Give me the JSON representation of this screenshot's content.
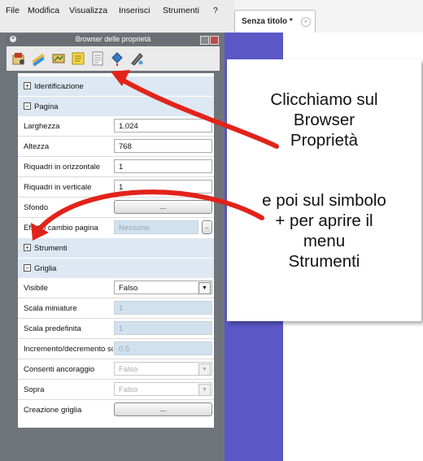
{
  "menubar": {
    "items": [
      "File",
      "Modifica",
      "Visualizza",
      "Inserisci",
      "Strumenti",
      "?"
    ]
  },
  "tab": {
    "label": "Senza titolo *",
    "close_icon": "close-icon"
  },
  "panel": {
    "title": "Browser delle proprietà",
    "tool_icons": [
      "page-settings-icon",
      "pencil-tools-icon",
      "flipchart-icon",
      "notes-icon",
      "properties-page-icon",
      "fill-bucket-icon",
      "pen-icon"
    ]
  },
  "sections": {
    "identificazione": {
      "label": "Identificazione",
      "expand": "+"
    },
    "pagina": {
      "label": "Pagina",
      "expand": "−"
    },
    "strumenti": {
      "label": "Strumenti",
      "expand": "+"
    },
    "griglia": {
      "label": "Griglia",
      "expand": "−"
    }
  },
  "pagina": {
    "larghezza": {
      "label": "Larghezza",
      "value": "1.024"
    },
    "altezza": {
      "label": "Altezza",
      "value": "768"
    },
    "riquadri_orizzontale": {
      "label": "Riquadri in orizzontale",
      "value": "1"
    },
    "riquadri_verticale": {
      "label": "Riquadri in verticale",
      "value": "1"
    },
    "sfondo": {
      "label": "Sfondo",
      "button": "..."
    },
    "effetto": {
      "label": "Effetto cambio pagina",
      "value": "Nessuno",
      "button": ".."
    }
  },
  "griglia": {
    "visibile": {
      "label": "Visibile",
      "value": "Falso"
    },
    "scala_miniature": {
      "label": "Scala miniature",
      "value": "1"
    },
    "scala_predefinita": {
      "label": "Scala predefinita",
      "value": "1"
    },
    "incremento": {
      "label": "Incremento/decremento sc",
      "value": "0,5"
    },
    "consenti": {
      "label": "Consenti ancoraggio",
      "value": "Falso"
    },
    "sopra": {
      "label": "Sopra",
      "value": "Falso"
    },
    "creazione": {
      "label": "Creazione griglia",
      "button": "..."
    }
  },
  "annotation": {
    "lines": [
      "Clicchiamo sul",
      "Browser",
      "Proprietà",
      "e poi sul simbolo",
      "+ per aprire il",
      "menu",
      "Strumenti"
    ]
  },
  "colors": {
    "arrow": "#e2231a",
    "canvas": "#5b57c7",
    "section": "#dde8f2",
    "disabled_field": "#d2e1ee"
  }
}
